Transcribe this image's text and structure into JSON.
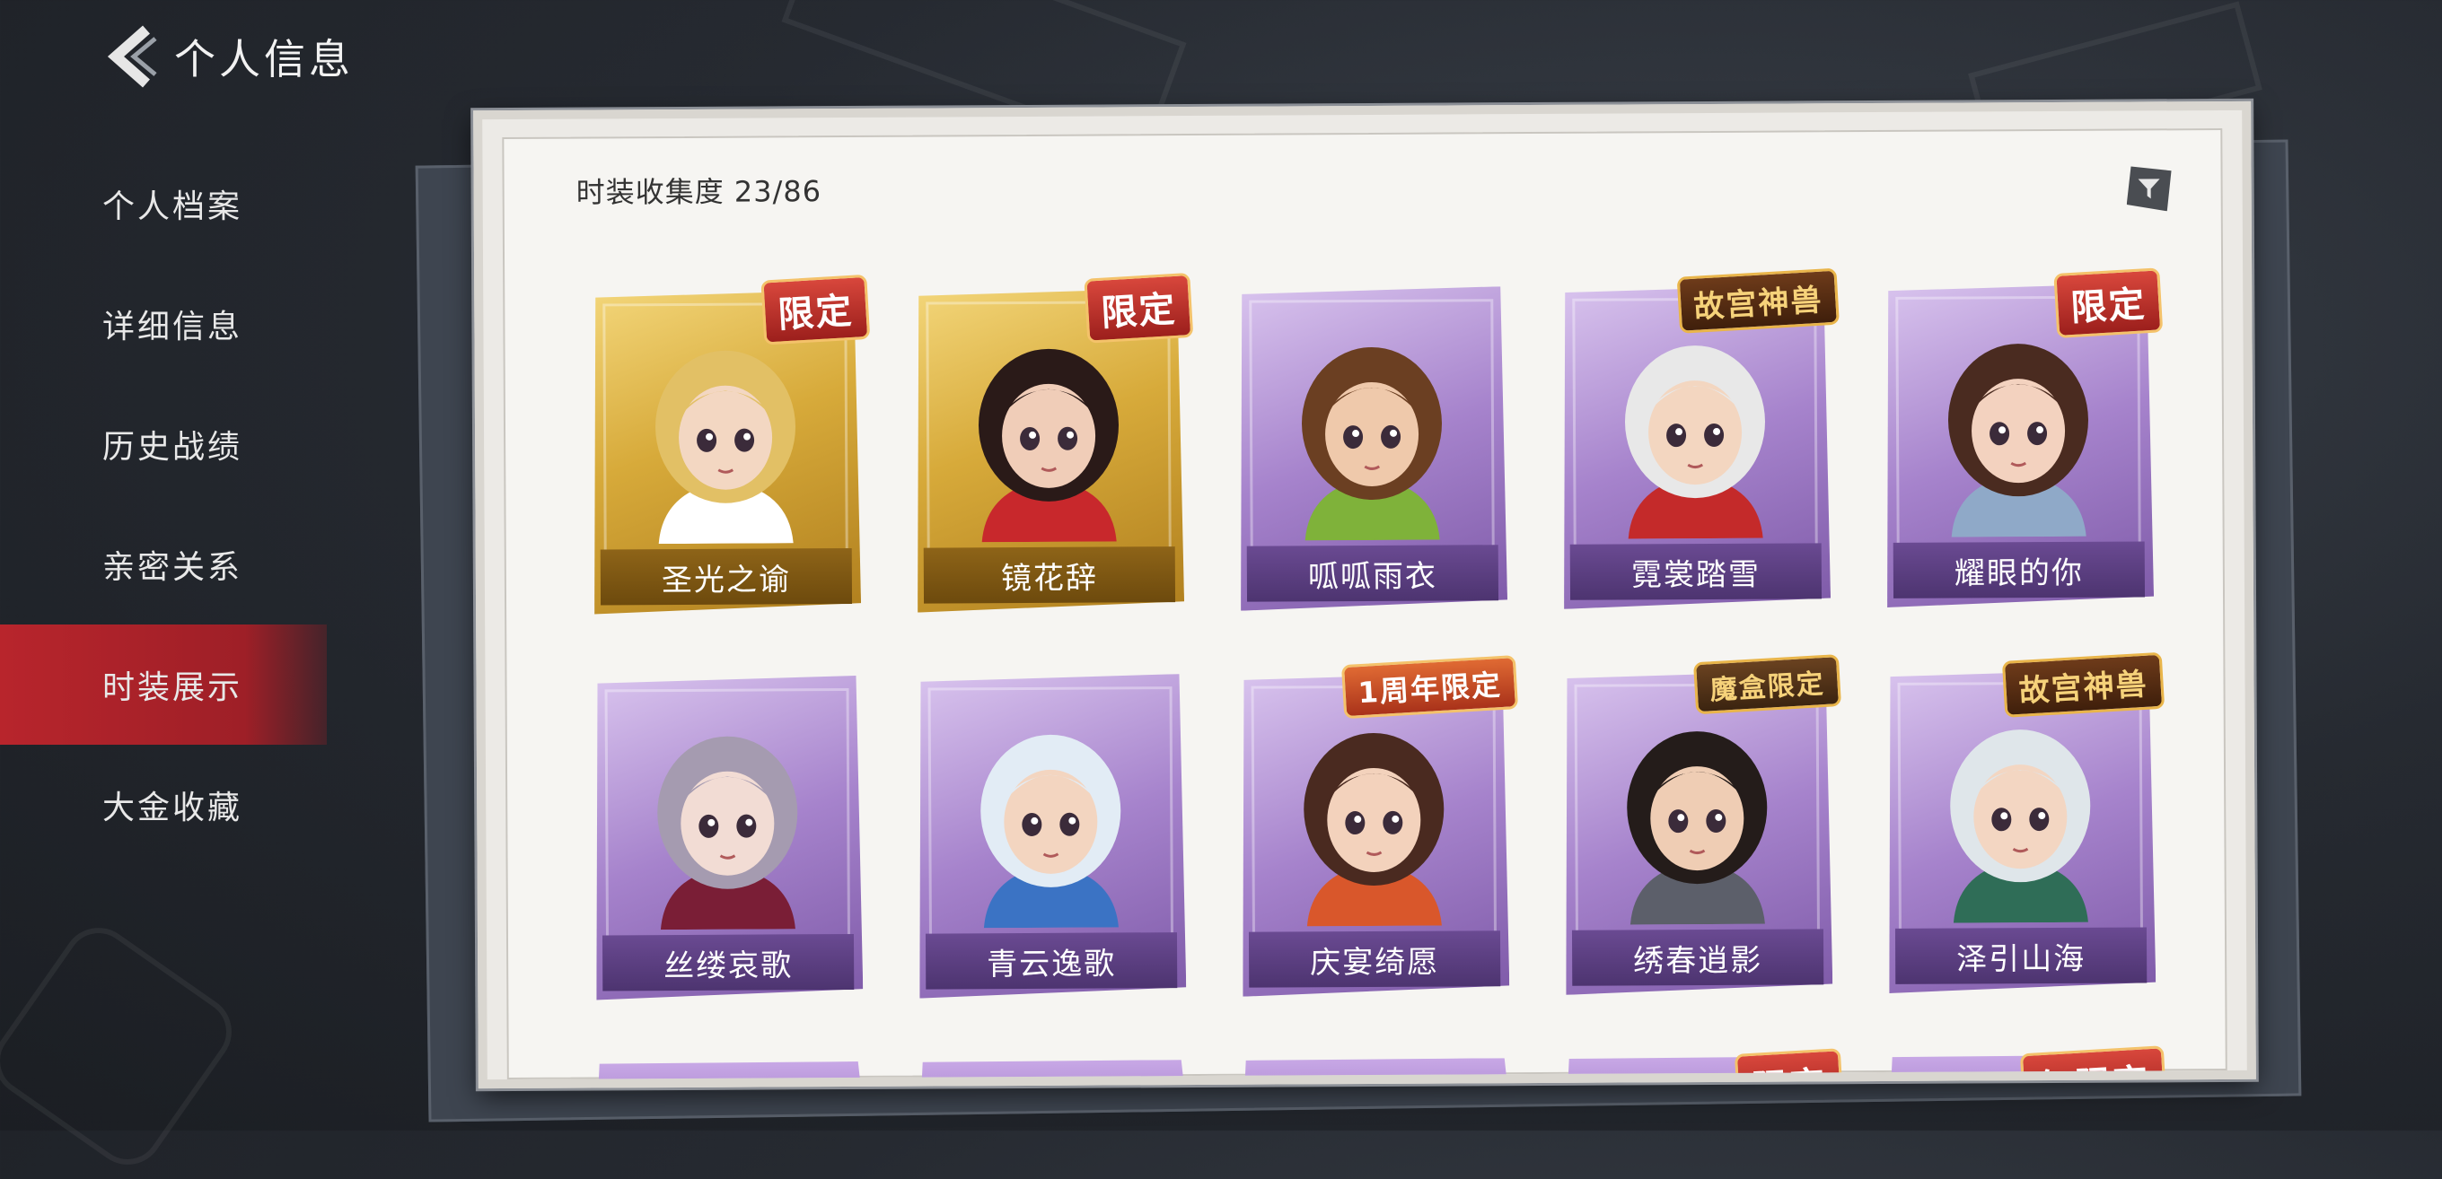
{
  "header": {
    "title": "个人信息"
  },
  "sidebar": {
    "items": [
      {
        "label": "个人档案"
      },
      {
        "label": "详细信息"
      },
      {
        "label": "历史战绩"
      },
      {
        "label": "亲密关系"
      },
      {
        "label": "时装展示",
        "active": true
      },
      {
        "label": "大金收藏"
      }
    ]
  },
  "collection": {
    "label": "时装收集度 23/86"
  },
  "cards": [
    {
      "name": "圣光之谕",
      "tier": "gold",
      "badge": "限定",
      "hair": "#e2c065",
      "skin": "#f3d7c2",
      "outfit": "#ffffff"
    },
    {
      "name": "镜花辞",
      "tier": "gold",
      "badge": "限定",
      "hair": "#2a1a18",
      "skin": "#f0cdb8",
      "outfit": "#c8282c"
    },
    {
      "name": "呱呱雨衣",
      "tier": "purple",
      "badge": "",
      "hair": "#6b3f22",
      "skin": "#efc9ab",
      "outfit": "#7fb23a"
    },
    {
      "name": "霓裳踏雪",
      "tier": "purple",
      "badge": "故宫神兽",
      "hair": "#e8e8e8",
      "skin": "#f3d6c0",
      "outfit": "#c42a2a"
    },
    {
      "name": "耀眼的你",
      "tier": "purple",
      "badge": "限定",
      "hair": "#4a2b20",
      "skin": "#f3d2bf",
      "outfit": "#8fa9c8"
    },
    {
      "name": "丝缕哀歌",
      "tier": "purple",
      "badge": "",
      "hair": "#a59bb0",
      "skin": "#f2dcd4",
      "outfit": "#7a1e36"
    },
    {
      "name": "青云逸歌",
      "tier": "purple",
      "badge": "",
      "hair": "#e2ecf5",
      "skin": "#f3d5c0",
      "outfit": "#3b73c4"
    },
    {
      "name": "庆宴绮愿",
      "tier": "purple",
      "badge": "1周年限定",
      "hair": "#4a2a20",
      "skin": "#f3d2bc",
      "outfit": "#d9572b"
    },
    {
      "name": "绣春逍影",
      "tier": "purple",
      "badge": "魔盒限定",
      "hair": "#241c1a",
      "skin": "#efcdb4",
      "outfit": "#5c5f6a"
    },
    {
      "name": "泽引山海",
      "tier": "purple",
      "badge": "故宫神兽",
      "hair": "#dfe6ea",
      "skin": "#f3d6c2",
      "outfit": "#2f6d57"
    }
  ],
  "peek_badges": [
    "",
    "",
    "",
    "限定",
    "年限定"
  ],
  "colors": {
    "accent": "#b8252c",
    "gold_card": "#d7aa3a",
    "purple_card": "#a683cc"
  },
  "icons": {
    "back": "chevron-left-icon",
    "filter": "filter-icon"
  }
}
